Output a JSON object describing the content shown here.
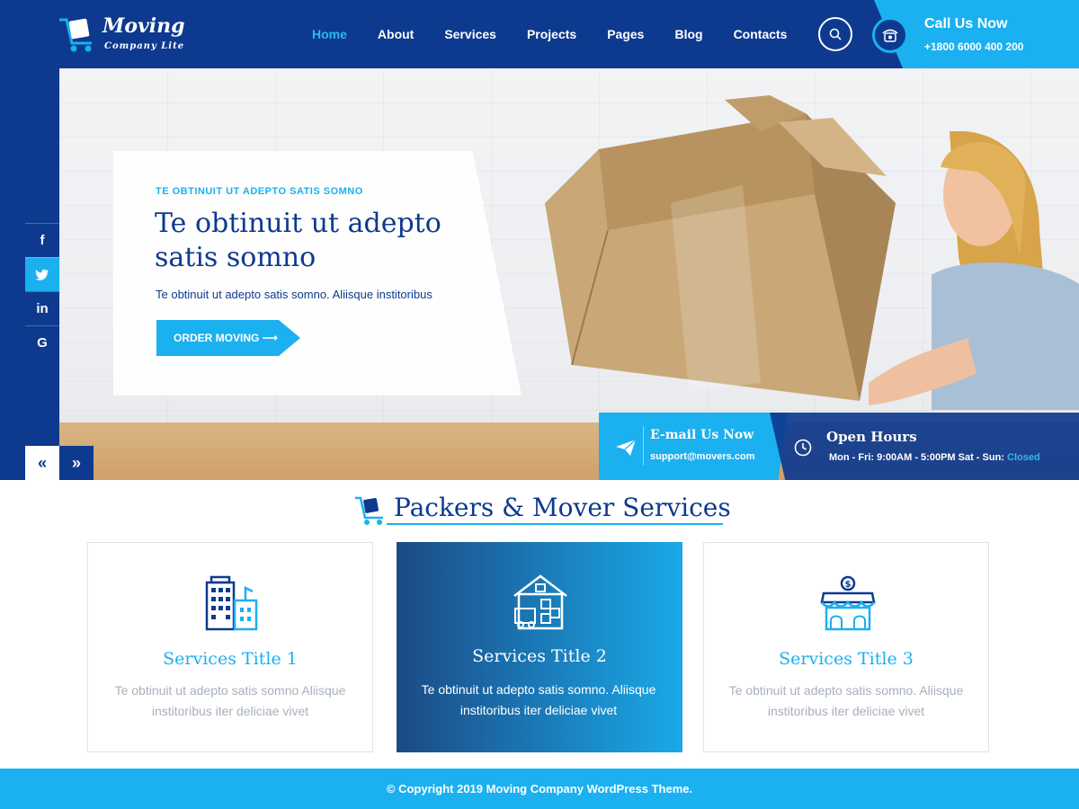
{
  "logo": {
    "main": "Moving",
    "sub": "Company Lite",
    "icon": "cart-icon"
  },
  "nav": {
    "items": [
      {
        "label": "Home",
        "active": true
      },
      {
        "label": "About",
        "active": false
      },
      {
        "label": "Services",
        "active": false
      },
      {
        "label": "Projects",
        "active": false
      },
      {
        "label": "Pages",
        "active": false
      },
      {
        "label": "Blog",
        "active": false
      },
      {
        "label": "Contacts",
        "active": false
      }
    ],
    "search_icon": "search-icon"
  },
  "call": {
    "title": "Call Us Now",
    "number": "+1800 6000 400 200",
    "icon": "phone-icon"
  },
  "social": [
    {
      "label": "f",
      "icon": "facebook-icon"
    },
    {
      "label": "t",
      "icon": "twitter-icon"
    },
    {
      "label": "in",
      "icon": "linkedin-icon"
    },
    {
      "label": "G",
      "icon": "google-icon"
    }
  ],
  "hero": {
    "kicker": "TE OBTINUIT UT ADEPTO SATIS SOMNO",
    "title": "Te obtinuit ut adepto satis somno",
    "text": "Te obtinuit ut adepto satis somno. Aliisque institoribus",
    "button": "ORDER MOVING ⟶",
    "prev": "«",
    "next": "»"
  },
  "email": {
    "title": "E-mail Us Now",
    "address": "support@movers.com",
    "icon": "paper-plane-icon"
  },
  "hours": {
    "title": "Open Hours",
    "text": "Mon - Fri: 9:00AM - 5:00PM Sat - Sun: ",
    "closed": "Closed",
    "icon": "clock-icon"
  },
  "services": {
    "heading": "Packers & Mover Services",
    "cards": [
      {
        "title": "Services Title 1",
        "text": "Te obtinuit ut adepto satis somno Aliisque institoribus iter deliciae vivet",
        "icon": "office-building-icon"
      },
      {
        "title": "Services Title 2",
        "text": "Te obtinuit ut adepto satis somno. Aliisque institoribus iter deliciae vivet",
        "icon": "warehouse-truck-icon"
      },
      {
        "title": "Services Title 3",
        "text": "Te obtinuit ut adepto satis somno. Aliisque institoribus iter deliciae vivet",
        "icon": "storefront-icon"
      }
    ]
  },
  "footer": {
    "text": "© Copyright 2019 Moving Company WordPress Theme."
  },
  "colors": {
    "primary": "#0d3a8f",
    "accent": "#1bb0f0"
  }
}
